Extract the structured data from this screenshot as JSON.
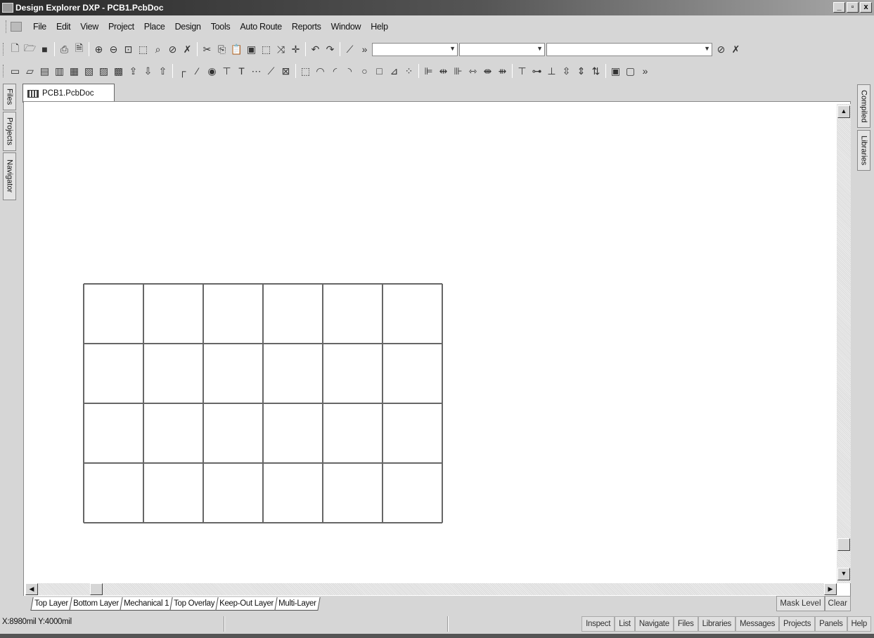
{
  "window": {
    "title": "Design Explorer DXP - PCB1.PcbDoc",
    "min": "_",
    "max": "▫",
    "close": "x"
  },
  "menu": [
    "File",
    "Edit",
    "View",
    "Project",
    "Place",
    "Design",
    "Tools",
    "Auto Route",
    "Reports",
    "Window",
    "Help"
  ],
  "left_panel_tabs": [
    "Files",
    "Projects",
    "Navigator"
  ],
  "right_panel_tabs": [
    "Compiled",
    "Libraries"
  ],
  "document_tab": "PCB1.PcbDoc",
  "board_grid": {
    "rows": 4,
    "columns": 6,
    "line_color": "#666666"
  },
  "layer_tabs": [
    "Top Layer",
    "Bottom Layer",
    "Mechanical 1",
    "Top Overlay",
    "Keep-Out Layer",
    "Multi-Layer"
  ],
  "mask_buttons": [
    "Mask Level",
    "Clear"
  ],
  "status": {
    "coordinates": "X:8980mil Y:4000mil"
  },
  "panel_buttons": [
    "Inspect",
    "List",
    "Navigate",
    "Files",
    "Libraries",
    "Messages",
    "Projects",
    "Panels",
    "Help"
  ]
}
